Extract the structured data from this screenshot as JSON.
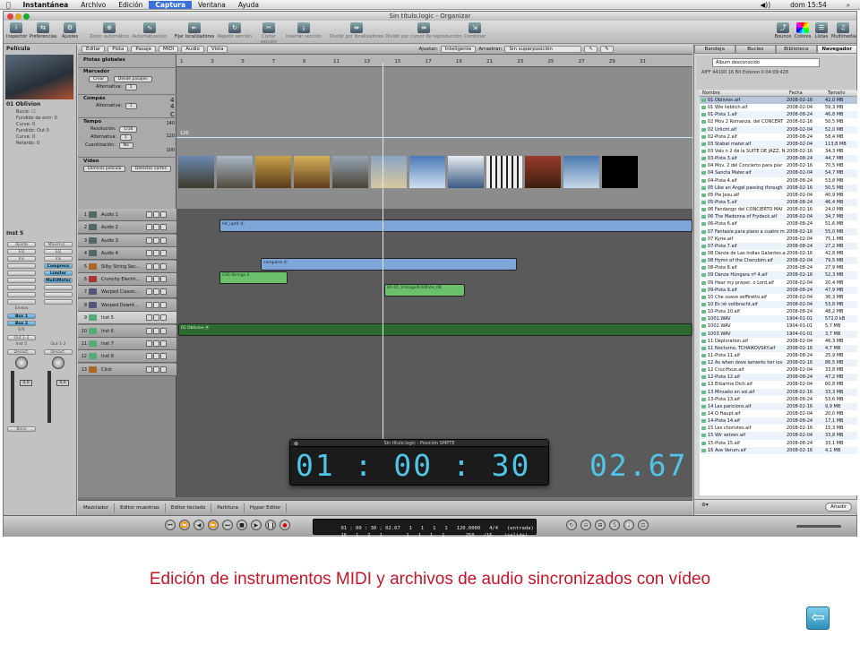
{
  "menubar": {
    "apple": "",
    "items": [
      "Instantánea",
      "Archivo",
      "Edición",
      "Captura",
      "Ventana",
      "Ayuda"
    ],
    "selected": "Captura",
    "clock": "dom 15:54"
  },
  "window": {
    "title": "Sin título.logic - Organizar"
  },
  "toolbar": {
    "left": [
      "Inspector",
      "Preferencias",
      "Ajustes"
    ],
    "middle": [
      "Zoom automático",
      "Automatización",
      "Fijar localizadores",
      "Repetir sección",
      "Cortar sección",
      "Insertar sección",
      "Dividir por localizadores",
      "Dividir por cursor de reproducción",
      "Combinar"
    ],
    "right": [
      "Bounce",
      "Colores",
      "Listas",
      "Multimedia"
    ]
  },
  "inspector": {
    "region_header": "Película",
    "region_name": "01 Oblivion",
    "params": [
      {
        "k": "Bucle:",
        "v": "☐"
      },
      {
        "k": "Fundido de entr:",
        "v": "0"
      },
      {
        "k": "Curva:",
        "v": "0"
      },
      {
        "k": "Fundido: Out",
        "v": "0"
      },
      {
        "k": "Curva:",
        "v": "0"
      },
      {
        "k": "Retardo:",
        "v": "0"
      }
    ],
    "track_header": "Inst 5",
    "strip1": {
      "top": "Ajuste",
      "eq": "EQ",
      "ins": "Ins",
      "envios": "Envíos",
      "bus1": "Bus 1",
      "bus2": "Bus 2",
      "io": "E/S",
      "out": "Out 1-2",
      "name": "Inst 5",
      "mode": "Desact.",
      "vol": "0,0",
      "btn": "Bnce"
    },
    "strip2": {
      "top": "Maximiz...",
      "eq": "EQ",
      "ins": "Ins",
      "plugins": [
        "Compress",
        "Limiter",
        "MultiMeter"
      ],
      "out": "Out 1-2",
      "name": "Out 1-2",
      "mode": "Desact.",
      "vol": "0,0"
    }
  },
  "arrange_toolbar": {
    "menus": [
      "Editar",
      "Pista",
      "Pasaje",
      "MIDI",
      "Audio",
      "Vista"
    ],
    "snap_label": "Ajustar:",
    "snap_value": "Inteligente",
    "drag_label": "Arrastrar:",
    "drag_value": "Sin superposición"
  },
  "global_tracks": {
    "title": "Pistas globales",
    "marker": "Marcador",
    "create": "Crear",
    "from_passages": "Desde pasajes",
    "alternative": "Alternativa:",
    "alt_value": "1",
    "sig": "Compás",
    "sig_values": [
      "4",
      "4",
      "C"
    ],
    "tempo": "Tempo",
    "tempo_scale": [
      "140",
      "120",
      "100"
    ],
    "tempo_value": "120",
    "resolution": "Resolución:",
    "res_value": "1/16",
    "quant": "Cuantización:",
    "quant_value": "No",
    "video": "Vídeo",
    "remove_movie": "Eliminar película",
    "detect_cuts": "Detectar cortes"
  },
  "ruler": [
    "1",
    "3",
    "5",
    "7",
    "9",
    "11",
    "13",
    "15",
    "17",
    "19",
    "21",
    "23",
    "25",
    "27",
    "29",
    "31"
  ],
  "tracks": [
    {
      "num": "1",
      "name": "Audio 1"
    },
    {
      "num": "2",
      "name": "Audio 2"
    },
    {
      "num": "3",
      "name": "Audio 3"
    },
    {
      "num": "4",
      "name": "Audio 4"
    },
    {
      "num": "5",
      "name": "Silky String Sec..."
    },
    {
      "num": "6",
      "name": "Crunchy Electri..."
    },
    {
      "num": "7",
      "name": "Warped Classic..."
    },
    {
      "num": "8",
      "name": "Warped Downt..."
    },
    {
      "num": "9",
      "name": "Inst 5"
    },
    {
      "num": "10",
      "name": "Inst 6"
    },
    {
      "num": "11",
      "name": "Inst 7"
    },
    {
      "num": "12",
      "name": "Inst 8"
    },
    {
      "num": "13",
      "name": "Click"
    }
  ],
  "regions": {
    "r1": "hit_uptit ⦿",
    "r2": "campana ⦿",
    "r3": "CSS Strings 2",
    "r4": "8A 01_VintagePickMute_08",
    "r5": "01 Oblivion ⦿"
  },
  "bottom_tabs": [
    "Mezclador",
    "Editor muestras",
    "Editor teclado",
    "Partitura",
    "Hyper Editor"
  ],
  "browser": {
    "tabs": [
      "Bandeja",
      "Bucles",
      "Biblioteca",
      "Navegador"
    ],
    "active_tab": "Navegador",
    "album": "Álbum desconocido",
    "format": "AIFF  44100  16 Bit  Estéreo  0:04:09:428",
    "columns": [
      "Nombre",
      "Fecha",
      "Tamaño"
    ],
    "rows": [
      [
        "01 Oblivion.aif",
        "2008-02-16",
        "42,0 MB"
      ],
      [
        "01 Wie lieblich.aif",
        "2008-02-04",
        "59,3 MB"
      ],
      [
        "01-Pista 1.aif",
        "2008-08-24",
        "46,8 MB"
      ],
      [
        "02 Mov 2 Romanza, del CONCERT",
        "2008-02-16",
        "50,5 MB"
      ],
      [
        "02 Urlicht.aif",
        "2008-02-04",
        "52,0 MB"
      ],
      [
        "02-Pista 2.aif",
        "2008-08-24",
        "58,4 MB"
      ],
      [
        "03 Stabat mater.aif",
        "2008-02-04",
        "113,8 MB"
      ],
      [
        "03 Vals n 2 de la SUITE DE JAZZ, N",
        "2008-02-16",
        "34,3 MB"
      ],
      [
        "03-Pista 3.aif",
        "2008-08-24",
        "44,7 MB"
      ],
      [
        "04 Mov. 2 del Concierto para piar",
        "2008-02-16",
        "70,5 MB"
      ],
      [
        "04 Sancta Mater.aif",
        "2008-02-04",
        "54,7 MB"
      ],
      [
        "04-Pista 4.aif",
        "2008-08-24",
        "53,8 MB"
      ],
      [
        "05 Like an Angel passing through",
        "2008-02-16",
        "50,5 MB"
      ],
      [
        "05 Pie Jesu.aif",
        "2008-02-04",
        "40,9 MB"
      ],
      [
        "05-Pista 5.aif",
        "2008-08-24",
        "46,4 MB"
      ],
      [
        "06 Fandango del CONCIERTO MAI",
        "2008-02-16",
        "24,0 MB"
      ],
      [
        "06 The Madonna of Frydeck.aif",
        "2008-02-04",
        "34,7 MB"
      ],
      [
        "06-Pista 6.aif",
        "2008-08-24",
        "51,6 MB"
      ],
      [
        "07 Fantasía para piano a cuatro m",
        "2008-02-16",
        "55,0 MB"
      ],
      [
        "07 Kyrie.aif",
        "2008-02-04",
        "75,1 MB"
      ],
      [
        "07-Pista 7.aif",
        "2008-08-24",
        "27,2 MB"
      ],
      [
        "08 Danza de Las Indias Galantes.a",
        "2008-02-16",
        "42,8 MB"
      ],
      [
        "08 Hymn of the Cherubim.aif",
        "2008-02-04",
        "79,5 MB"
      ],
      [
        "08-Pista 8.aif",
        "2008-08-24",
        "27,9 MB"
      ],
      [
        "09 Danza Húngara nº 4.aif",
        "2008-02-16",
        "52,3 MB"
      ],
      [
        "09 Hear my prayer, o Lord.aif",
        "2008-02-04",
        "20,4 MB"
      ],
      [
        "09-Pista 9.aif",
        "2008-08-24",
        "47,9 MB"
      ],
      [
        "10 Che soave zeffiretto.aif",
        "2008-02-04",
        "36,3 MB"
      ],
      [
        "10 Es ist vollbracht.aif",
        "2008-02-04",
        "53,8 MB"
      ],
      [
        "10-Pista 10.aif",
        "2008-08-24",
        "48,2 MB"
      ],
      [
        "1001.WAV",
        "1904-01-01",
        "572,0 kB"
      ],
      [
        "1002.WAV",
        "1904-01-01",
        "5,7 MB"
      ],
      [
        "1003.WAV",
        "1904-01-01",
        "3,7 MB"
      ],
      [
        "11 Déploration.aif",
        "2008-02-04",
        "46,3 MB"
      ],
      [
        "11 Nocturno, TCHAIKOVSKY.aif",
        "2008-02-16",
        "4,7 MB"
      ],
      [
        "11-Pista 11.aif",
        "2008-08-24",
        "25,9 MB"
      ],
      [
        "12 As when dove laments her lov",
        "2008-02-16",
        "86,5 MB"
      ],
      [
        "12 Crucifixus.aif",
        "2008-02-04",
        "33,8 MB"
      ],
      [
        "12-Pista 12.aif",
        "2008-08-24",
        "47,2 MB"
      ],
      [
        "13 Erbarme Dich.aif",
        "2008-02-04",
        "60,8 MB"
      ],
      [
        "13 Minueto en sol.aif",
        "2008-02-16",
        "33,3 MB"
      ],
      [
        "13-Pista 13.aif",
        "2008-08-24",
        "53,6 MB"
      ],
      [
        "14 Les paricions.aif",
        "2008-02-16",
        "9,9 MB"
      ],
      [
        "14 O Haupt.aif",
        "2008-02-04",
        "20,0 MB"
      ],
      [
        "14-Pista 14.aif",
        "2008-08-24",
        "17,1 MB"
      ],
      [
        "15 Les choristes.aif",
        "2008-02-16",
        "15,3 MB"
      ],
      [
        "15 Wir setzen.aif",
        "2008-02-04",
        "33,8 MB"
      ],
      [
        "15-Pista 15.aif",
        "2008-08-24",
        "33,1 MB"
      ],
      [
        "16 Ave Verum.aif",
        "2008-02-16",
        "4,1 MB"
      ]
    ],
    "add_button": "Añadir"
  },
  "transport": {
    "lcd_row1": [
      "01 : 00 : 30 ; 02.67",
      "1   1   1   1",
      "120.0000",
      "4/4",
      "(entrada)"
    ],
    "lcd_row2": [
      "16   1   2   1",
      "1   1   1   1",
      "250",
      "/16",
      "(salida)"
    ]
  },
  "smpte": {
    "title": "Sin título.logic - Posición SMPTE",
    "time": "01 : 00 : 30   02.67"
  },
  "caption": "Edición de instrumentos MIDI y archivos de audio sincronizados con vídeo",
  "nav": {
    "back_icon": "back-arrow-icon"
  }
}
